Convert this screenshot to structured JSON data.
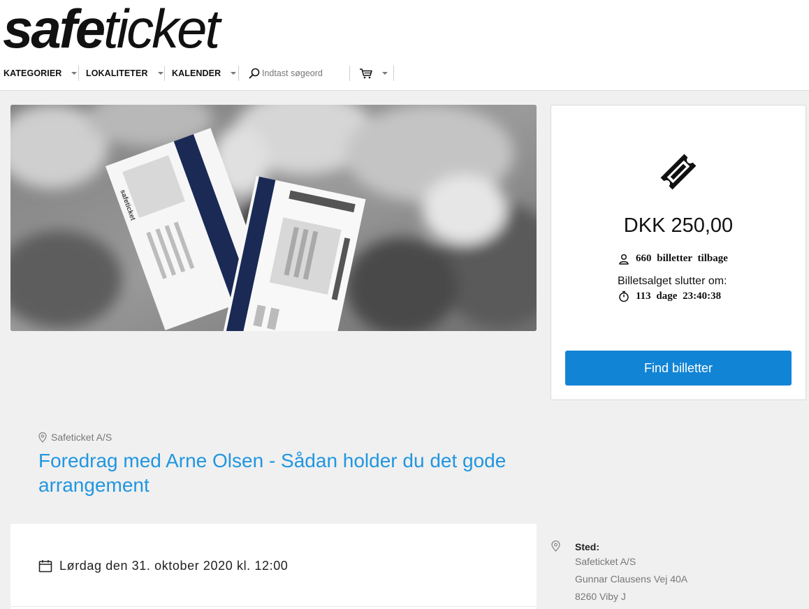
{
  "brand": {
    "logo_bold": "safe",
    "logo_light": "ticket"
  },
  "nav": {
    "categories": "KATEGORIER",
    "venues": "LOKALITETER",
    "calendar": "KALENDER",
    "search_placeholder": "Indtast søgeord",
    "cart_icon": "cart-icon"
  },
  "hero": {
    "ticket_brand": "safeticket"
  },
  "purchase": {
    "price": "DKK 250,00",
    "tickets_left": "660 billetter tilbage",
    "sale_ends_label": "Billetsalget slutter om:",
    "countdown": "113 dage 23:40:38",
    "find_button": "Find billetter"
  },
  "event": {
    "organizer": "Safeticket A/S",
    "title": "Foredrag med Arne Olsen - Sådan holder du det gode arrangement",
    "date": "Lørdag den 31. oktober 2020 kl. 12:00"
  },
  "venue": {
    "label": "Sted:",
    "name": "Safeticket A/S",
    "street": "Gunnar Clausens Vej 40A",
    "city": "8260 Viby J"
  },
  "colors": {
    "accent": "#1284d6",
    "title_blue": "#2196e0",
    "ticket_navy": "#1a2a55"
  }
}
